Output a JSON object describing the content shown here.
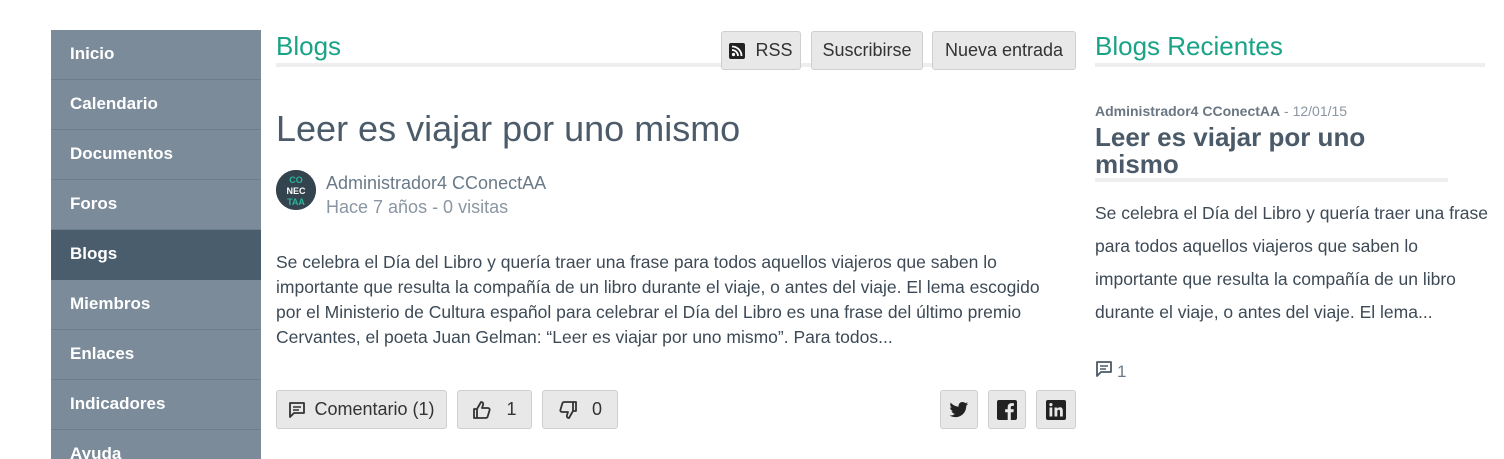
{
  "sidebar": {
    "items": [
      {
        "label": "Inicio"
      },
      {
        "label": "Calendario"
      },
      {
        "label": "Documentos"
      },
      {
        "label": "Foros"
      },
      {
        "label": "Blogs",
        "active": true
      },
      {
        "label": "Miembros"
      },
      {
        "label": "Enlaces"
      },
      {
        "label": "Indicadores"
      },
      {
        "label": "Ayuda"
      }
    ]
  },
  "main": {
    "section_title": "Blogs",
    "rss_label": "RSS",
    "subscribe_label": "Suscribirse",
    "new_post_label": "Nueva entrada",
    "post": {
      "title": "Leer es viajar por uno mismo",
      "avatar_text": "CCONECTAA",
      "author": "Administrador4 CConectAA",
      "meta": "Hace 7 años - 0 visitas",
      "excerpt": "Se celebra el Día del Libro y quería traer una frase para todos aquellos viajeros que saben lo importante que resulta la compañía de un libro durante el viaje, o antes del viaje. El lema escogido por el Ministerio de Cultura español para celebrar el Día del Libro es una frase del último premio Cervantes, el poeta Juan Gelman: “Leer es viajar por uno mismo”. Para todos...",
      "comment_label": "Comentario (1)",
      "likes": "1",
      "dislikes": "0"
    }
  },
  "recent": {
    "section_title": "Blogs Recientes",
    "author": "Administrador4 CConectAA",
    "date": " - 12/01/15",
    "title": "Leer es viajar por uno mismo",
    "excerpt": "Se celebra el Día del Libro y quería traer una frase para todos aquellos viajeros que saben lo importante que resulta la compañía de un libro durante el viaje, o antes del viaje. El lema...",
    "comments": "1"
  },
  "colors": {
    "accent": "#1aa387",
    "sidebar": "#7b8b9a",
    "sidebar_active": "#4a5d6d"
  }
}
